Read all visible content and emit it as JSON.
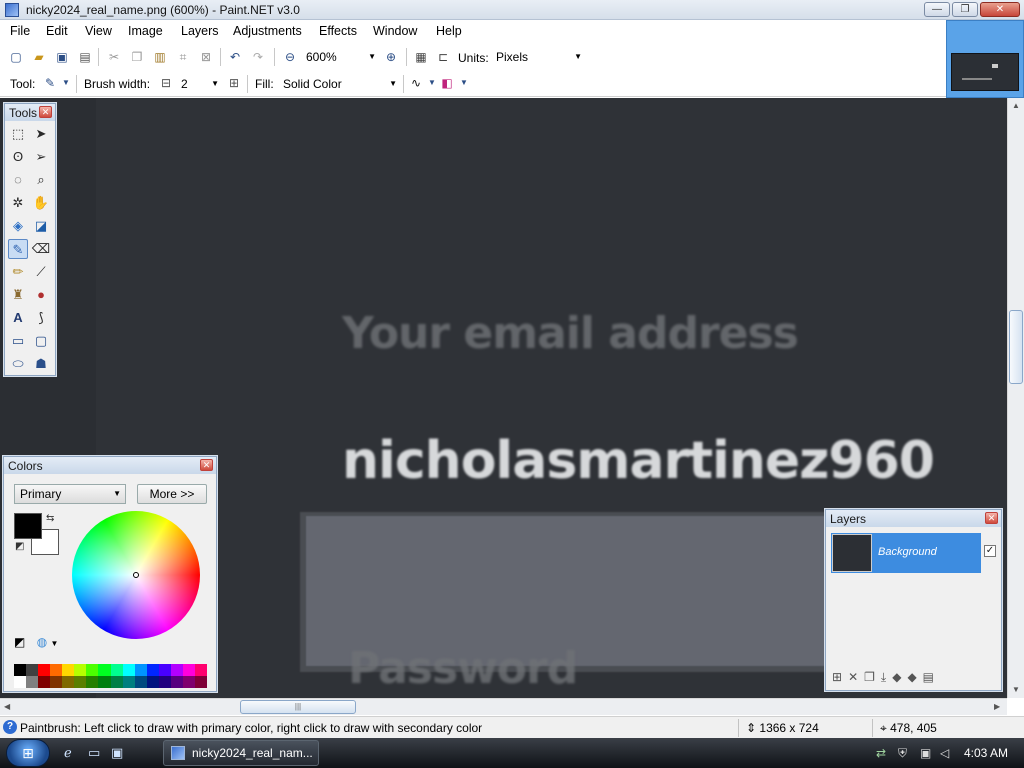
{
  "window": {
    "title": "nicky2024_real_name.png (600%) - Paint.NET v3.0",
    "controls": {
      "minimize": "—",
      "maximize": "❐",
      "close": "✕"
    }
  },
  "menu": [
    "File",
    "Edit",
    "View",
    "Image",
    "Layers",
    "Adjustments",
    "Effects",
    "Window",
    "Help"
  ],
  "toolbar": {
    "zoom_value": "600%",
    "units_label": "Units:",
    "units_value": "Pixels",
    "tool_label": "Tool:",
    "brush_width_label": "Brush width:",
    "brush_width_value": "2",
    "fill_label": "Fill:",
    "fill_value": "Solid Color"
  },
  "canvas": {
    "email_label": "Your email address",
    "email_value": "nicholasmartinez960",
    "password_label": "Password"
  },
  "tools_palette": {
    "title": "Tools",
    "close": "✕",
    "tools": [
      "rectangle-select",
      "move-selection",
      "lasso-select",
      "move-selected-pixels",
      "ellipse-select",
      "zoom",
      "magic-wand",
      "pan",
      "paint-bucket",
      "gradient",
      "paintbrush",
      "eraser",
      "pencil",
      "color-picker",
      "clone-stamp",
      "recolor",
      "text",
      "line-curve",
      "rectangle",
      "rounded-rectangle",
      "ellipse",
      "freeform-shape"
    ],
    "active_tool": "paintbrush"
  },
  "colors_palette": {
    "title": "Colors",
    "close": "✕",
    "mode_value": "Primary",
    "more_button": "More >>",
    "primary_color": "#000000",
    "secondary_color": "#ffffff",
    "swatches_top": [
      "#000000",
      "#404040",
      "#ff0000",
      "#ff6a00",
      "#ffd800",
      "#b6ff00",
      "#4cff00",
      "#00ff21",
      "#00ff90",
      "#00ffff",
      "#0094ff",
      "#0026ff",
      "#4800ff",
      "#b200ff",
      "#ff00dc",
      "#ff006e"
    ],
    "swatches_bottom": [
      "#ffffff",
      "#808080",
      "#7f0000",
      "#7f3300",
      "#7f6a00",
      "#5b7f00",
      "#267f00",
      "#007f0e",
      "#007f46",
      "#007f7f",
      "#004a7f",
      "#00137f",
      "#21007f",
      "#57007f",
      "#7f006e",
      "#7f0037"
    ]
  },
  "layers_palette": {
    "title": "Layers",
    "close": "✕",
    "layer_name": "Background",
    "layer_visible": "✓"
  },
  "statusbar": {
    "message": "Paintbrush: Left click to draw with primary color, right click to draw with secondary color",
    "image_size": "1366 x 724",
    "cursor_position": "478, 405"
  },
  "taskbar": {
    "task_label": "nicky2024_real_nam...",
    "clock": "4:03 AM"
  },
  "scrollbar": {
    "grip": "|||"
  }
}
